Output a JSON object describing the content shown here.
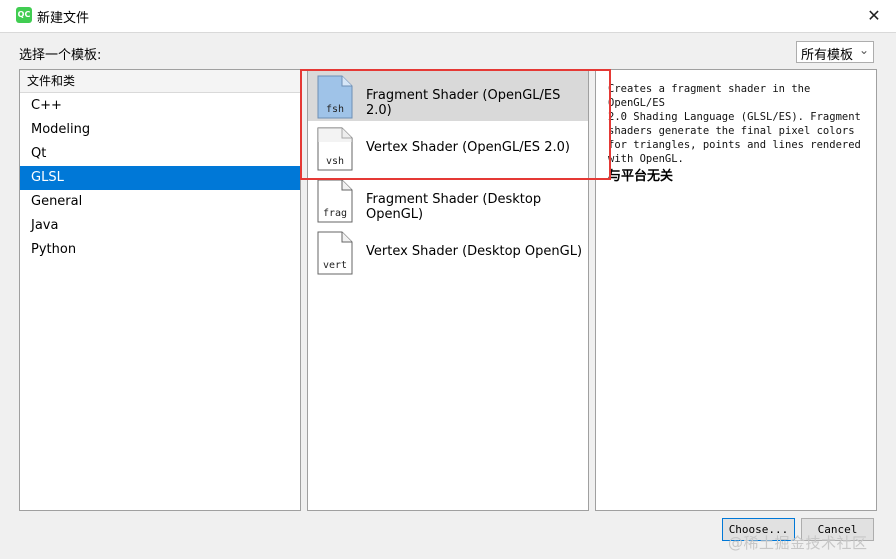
{
  "window": {
    "title": "新建文件",
    "app_icon_text": "QC",
    "close_glyph": "✕"
  },
  "toolbar": {
    "label": "选择一个模板:",
    "filter": {
      "selected": "所有模板",
      "arrow_glyph": "⌄"
    }
  },
  "categories": {
    "header": "文件和类",
    "items": [
      {
        "label": "C++"
      },
      {
        "label": "Modeling"
      },
      {
        "label": "Qt"
      },
      {
        "label": "GLSL",
        "selected": true
      },
      {
        "label": "General"
      },
      {
        "label": "Java"
      },
      {
        "label": "Python"
      }
    ]
  },
  "templates": [
    {
      "label": "Fragment Shader (OpenGL/ES 2.0)",
      "ext": "fsh",
      "selected": true
    },
    {
      "label": "Vertex Shader (OpenGL/ES 2.0)",
      "ext": "vsh"
    },
    {
      "label": "Fragment Shader (Desktop OpenGL)",
      "ext": "frag"
    },
    {
      "label": "Vertex Shader (Desktop OpenGL)",
      "ext": "vert"
    }
  ],
  "description": {
    "lines": [
      "Creates a fragment shader in the OpenGL/ES",
      "2.0 Shading Language (GLSL/ES). Fragment",
      "shaders generate the final pixel colors",
      "for triangles, points and lines rendered",
      "with OpenGL."
    ],
    "platform": "与平台无关"
  },
  "buttons": {
    "choose": "Choose...",
    "cancel": "Cancel"
  },
  "watermark": "@稀土掘金技术社区",
  "colors": {
    "selection": "#0078d7",
    "template_selection": "#cce8ff",
    "annotation": "#e53935"
  }
}
